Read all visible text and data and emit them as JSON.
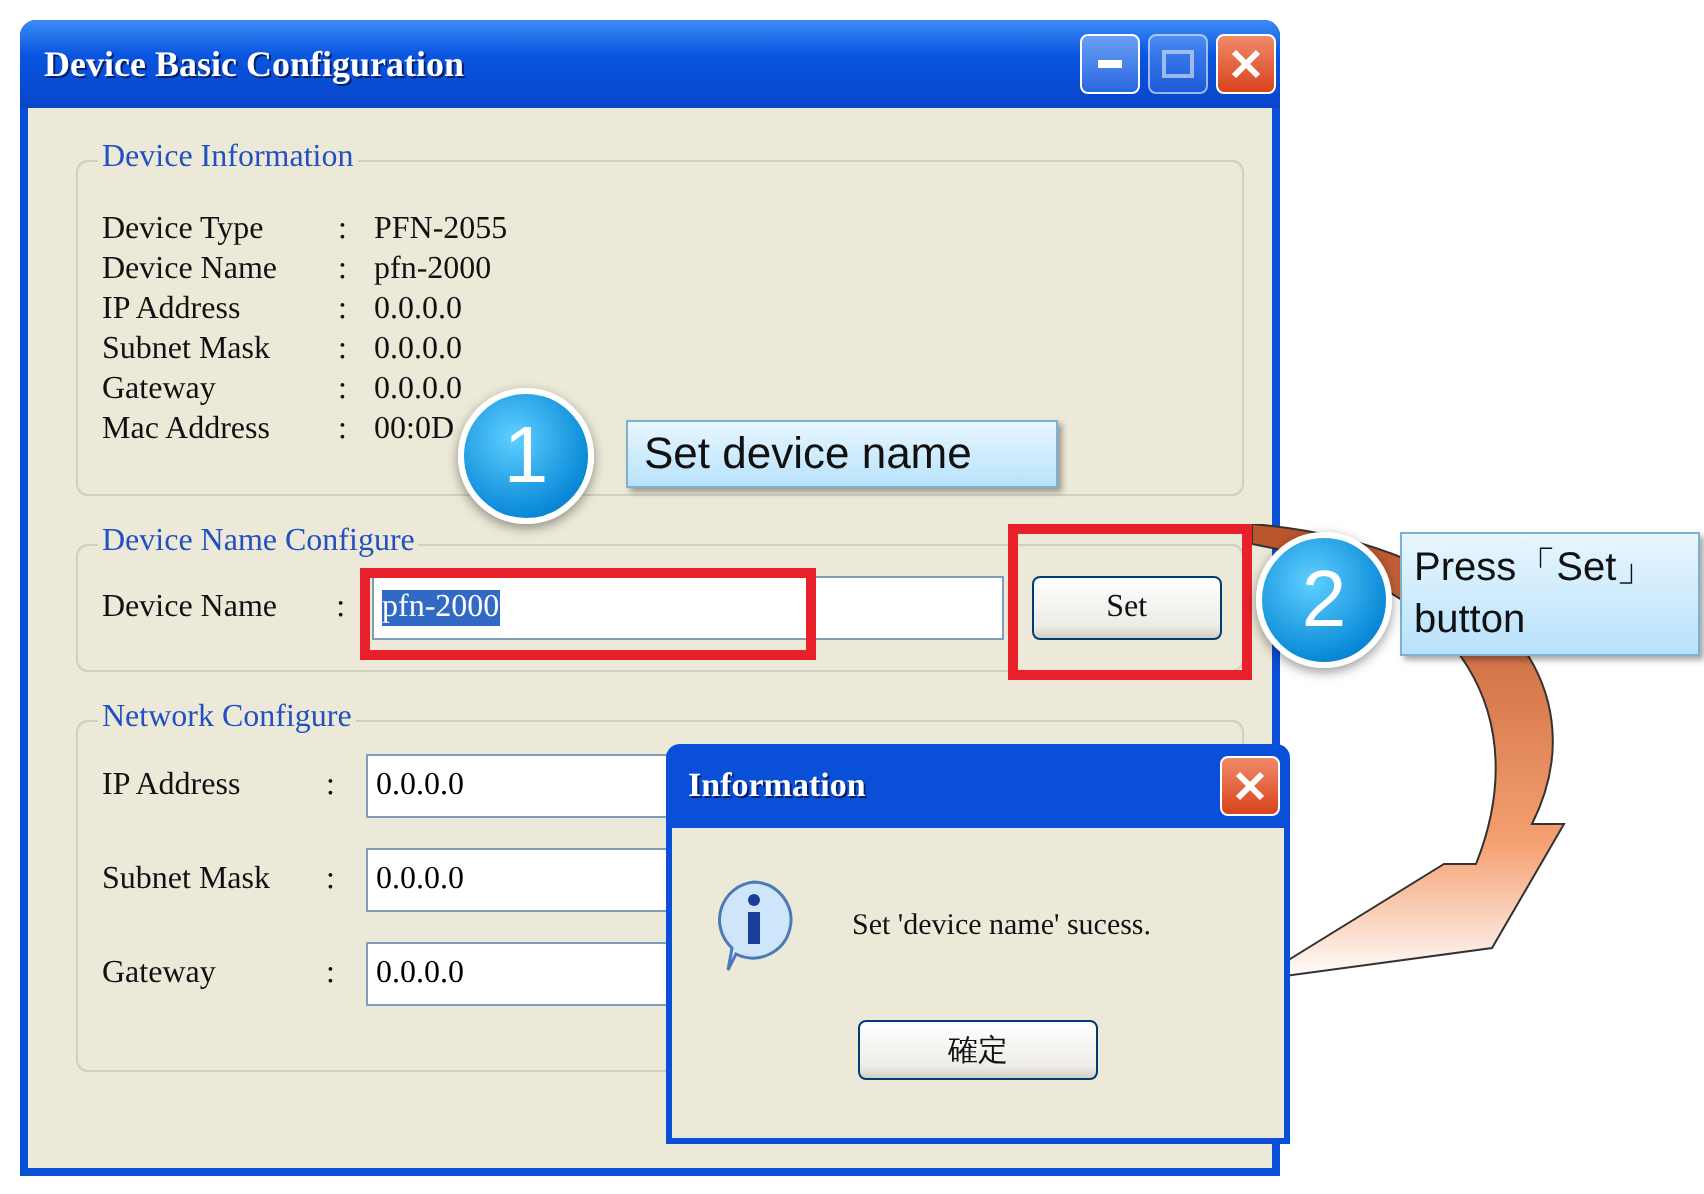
{
  "window": {
    "title": "Device Basic Configuration"
  },
  "device_information": {
    "title": "Device Information",
    "rows": [
      {
        "label": "Device Type",
        "separator": ":",
        "value": "PFN-2055"
      },
      {
        "label": "Device Name",
        "separator": ":",
        "value": "pfn-2000"
      },
      {
        "label": "IP Address",
        "separator": ":",
        "value": "0.0.0.0"
      },
      {
        "label": "Subnet Mask",
        "separator": ":",
        "value": "0.0.0.0"
      },
      {
        "label": "Gateway",
        "separator": ":",
        "value": "0.0.0.0"
      },
      {
        "label": "Mac Address",
        "separator": ":",
        "value": "00:0D"
      }
    ]
  },
  "device_name_configure": {
    "title": "Device Name Configure",
    "label": "Device Name",
    "separator": ":",
    "value": "pfn-2000",
    "value_selected": true,
    "button": "Set"
  },
  "network_configure": {
    "title": "Network Configure",
    "fields": [
      {
        "label": "IP Address",
        "separator": ":",
        "value": "0.0.0.0"
      },
      {
        "label": "Subnet Mask",
        "separator": ":",
        "value": "0.0.0.0"
      },
      {
        "label": "Gateway",
        "separator": ":",
        "value": "0.0.0.0"
      }
    ]
  },
  "dialog": {
    "title": "Information",
    "message": "Set 'device name' sucess.",
    "button": "確定"
  },
  "callouts": [
    {
      "number": "1",
      "text": "Set device name"
    },
    {
      "number": "2",
      "text": "Press「Set」button"
    }
  ]
}
